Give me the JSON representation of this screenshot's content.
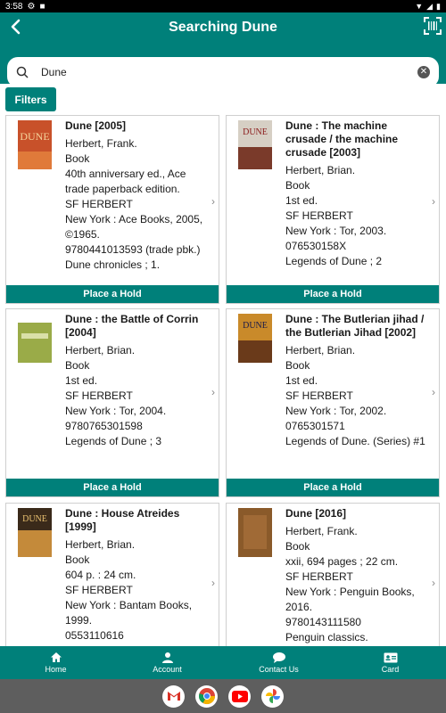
{
  "status": {
    "time": "3:58"
  },
  "header": {
    "title": "Searching Dune"
  },
  "search": {
    "value": "Dune"
  },
  "filters_label": "Filters",
  "hold_label": "Place a Hold",
  "results": [
    {
      "title": "Dune [2005]",
      "lines": [
        "Herbert, Frank.",
        "Book",
        "40th anniversary ed., Ace trade paperback edition.",
        "SF HERBERT",
        "New York : Ace Books, 2005, ©1965.",
        "9780441013593 (trade pbk.)",
        "Dune chronicles ; 1."
      ],
      "cover_color": "#c8512a"
    },
    {
      "title": "Dune : The machine crusade / the machine crusade [2003]",
      "lines": [
        "Herbert, Brian.",
        "Book",
        "1st ed.",
        "SF HERBERT",
        "New York : Tor, 2003.",
        "076530158X",
        "Legends of Dune ; 2"
      ],
      "cover_color": "#b8a89a"
    },
    {
      "title": "Dune : the Battle of Corrin [2004]",
      "lines": [
        "Herbert, Brian.",
        "Book",
        "1st ed.",
        "SF HERBERT",
        "New York : Tor, 2004.",
        "9780765301598",
        "Legends of Dune ; 3"
      ],
      "cover_color": "#8fa040"
    },
    {
      "title": "Dune : The Butlerian jihad / the Butlerian Jihad [2002]",
      "lines": [
        "Herbert, Brian.",
        "Book",
        "1st ed.",
        "SF HERBERT",
        "New York : Tor, 2002.",
        "0765301571",
        "Legends of Dune. (Series) #1"
      ],
      "cover_color": "#b07a2a"
    },
    {
      "title": "Dune : House Atreides [1999]",
      "lines": [
        "Herbert, Brian.",
        "Book",
        "604 p. : 24 cm.",
        "SF HERBERT",
        "New York : Bantam Books, 1999.",
        "0553110616"
      ],
      "cover_color": "#3a2a1a"
    },
    {
      "title": "Dune [2016]",
      "lines": [
        "Herbert, Frank.",
        "Book",
        "xxii, 694 pages ; 22 cm.",
        "SF HERBERT",
        "New York : Penguin Books, 2016.",
        "9780143111580",
        "Penguin classics."
      ],
      "cover_color": "#8a5a2a"
    }
  ],
  "nav": [
    {
      "label": "Home",
      "icon": "home-icon"
    },
    {
      "label": "Account",
      "icon": "account-icon"
    },
    {
      "label": "Contact Us",
      "icon": "chat-icon"
    },
    {
      "label": "Card",
      "icon": "card-icon"
    }
  ],
  "taskbar_apps": [
    "gmail-icon",
    "chrome-icon",
    "youtube-icon",
    "photos-icon"
  ],
  "colors": {
    "primary": "#00807a",
    "statusbar": "#000000",
    "taskbar": "#5e5e5e"
  }
}
